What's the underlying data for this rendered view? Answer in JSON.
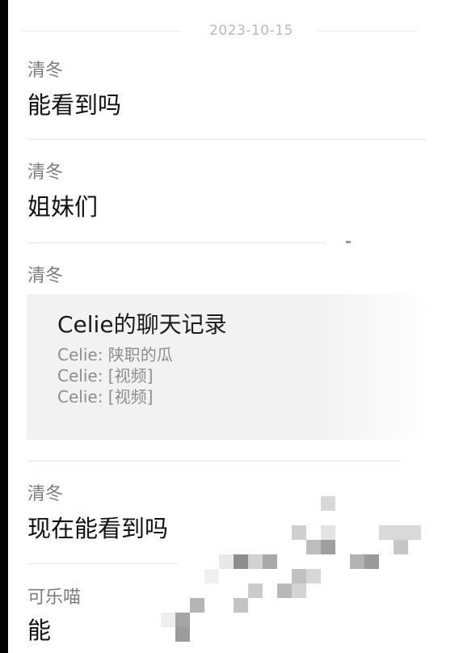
{
  "chat": {
    "date": "2023-10-15",
    "messages": [
      {
        "sender": "清冬",
        "text": "能看到吗"
      },
      {
        "sender": "清冬",
        "text": "姐妹们"
      },
      {
        "sender": "清冬",
        "card": {
          "title": "Celie的聊天记录",
          "lines": [
            "Celie: 陕职的瓜",
            "Celie: [视频]",
            "Celie: [视频]"
          ]
        }
      },
      {
        "sender": "清冬",
        "text": "现在能看到吗"
      },
      {
        "sender": "可乐喵",
        "text": "能"
      }
    ]
  },
  "colors": {
    "background": "#ffffff",
    "sender_text": "#7c7c7c",
    "message_text": "#111111",
    "card_background": "#f2f2f2",
    "divider": "#e6e6e6"
  }
}
